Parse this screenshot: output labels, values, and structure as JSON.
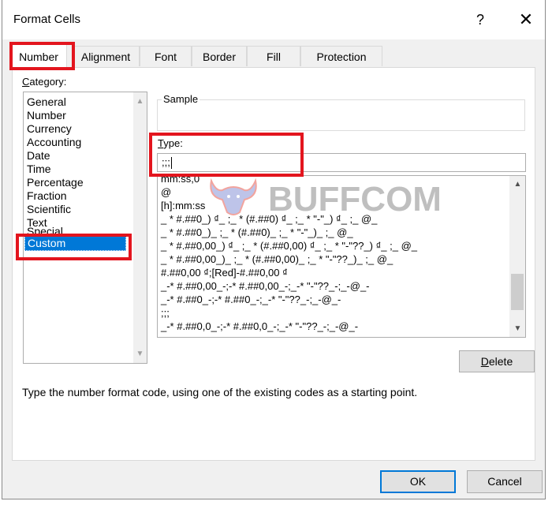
{
  "window": {
    "title": "Format Cells",
    "help_label": "?",
    "close_label": "✕"
  },
  "tabs": [
    {
      "label": "Number",
      "active": true
    },
    {
      "label": "Alignment",
      "active": false
    },
    {
      "label": "Font",
      "active": false
    },
    {
      "label": "Border",
      "active": false
    },
    {
      "label": "Fill",
      "active": false
    },
    {
      "label": "Protection",
      "active": false
    }
  ],
  "category": {
    "label_underlined": "C",
    "label_rest": "ategory:",
    "items": [
      "General",
      "Number",
      "Currency",
      "Accounting",
      "Date",
      "Time",
      "Percentage",
      "Fraction",
      "Scientific",
      "Text",
      "Special",
      "Custom"
    ],
    "selected": "Custom"
  },
  "sample": {
    "label": "Sample",
    "value": ""
  },
  "type": {
    "label_underlined": "T",
    "label_rest": "ype:",
    "value": ";;;"
  },
  "format_list": {
    "items": [
      "mm:ss,0",
      "@",
      "[h]:mm:ss",
      "_ * #.##0_) ₫_ ;_ * (#.##0) ₫_ ;_ * \"-\"_) ₫_ ;_ @_",
      "_ * #.##0_)_ ;_ * (#.##0)_ ;_ * \"-\"_)_ ;_ @_",
      "_ * #.##0,00_) ₫_ ;_ * (#.##0,00) ₫_ ;_ * \"-\"??_) ₫_ ;_ @_",
      "_ * #.##0,00_)_ ;_ * (#.##0,00)_ ;_ * \"-\"??_)_ ;_ @_",
      "#.##0,00 ₫;[Red]-#.##0,00 ₫",
      "_-* #.##0,00_-;-* #.##0,00_-;_-* \"-\"??_-;_-@_-",
      "_-* #.##0_-;-* #.##0_-;_-* \"-\"??_-;_-@_-",
      ";;;",
      "_-* #.##0,0_-;-* #.##0,0_-;_-* \"-\"??_-;_-@_-"
    ],
    "scroll_position": 0.88
  },
  "watermark": {
    "text": "BUFFCOM"
  },
  "buttons": {
    "delete_underlined": "D",
    "delete_rest": "elete",
    "ok": "OK",
    "cancel": "Cancel"
  },
  "hint": "Type the number format code, using one of the existing codes as a starting point.",
  "colors": {
    "highlight_red": "#e3151e",
    "selection_blue": "#0078d7",
    "watermark_gray": "#8c8c8c"
  }
}
